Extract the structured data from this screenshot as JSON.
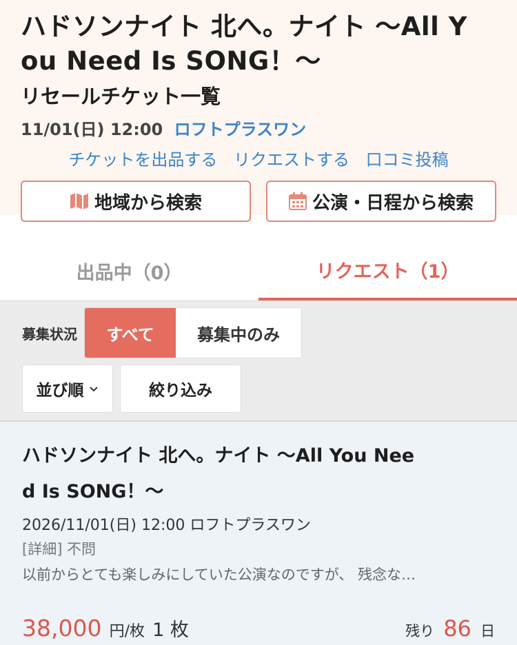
{
  "header": {
    "title_line1": "ハドソンナイト 北へ。ナイト 〜All Y",
    "title_line2": "ou Need Is SONG！〜",
    "subtitle": "リセールチケット一覧",
    "date": "11/01(日) 12:00",
    "venue": "ロフトプラスワン",
    "links": [
      "チケットを出品する",
      "リクエストする",
      "口コミ投稿"
    ],
    "search_region": "地域から検索",
    "search_schedule": "公演・日程から検索"
  },
  "tabs": [
    {
      "label": "出品中（0）",
      "active": false
    },
    {
      "label": "リクエスト（1）",
      "active": true
    }
  ],
  "filter": {
    "status_label": "募集状況",
    "segments": [
      "すべて",
      "募集中のみ"
    ],
    "sort_label": "並び順",
    "narrow_label": "絞り込み"
  },
  "listing": {
    "title_line1": "ハドソンナイト 北へ。ナイト 〜All You Nee",
    "title_line2": "d Is SONG！〜",
    "datetime_venue": "2026/11/01(日) 12:00 ロフトプラスワン",
    "detail": "[詳細] 不問",
    "description": "以前からとても楽しみにしていた公演なのですが、 残念な…",
    "price": "38,000",
    "price_unit": "円/枚",
    "quantity": "1 枚",
    "remaining_label": "残り",
    "remaining_days": "86",
    "days_unit": "日"
  },
  "colors": {
    "accent": "#e2655a",
    "link": "#3b84c9",
    "header_bg": "#fdf6f1",
    "card_bg": "#eef3f8"
  }
}
